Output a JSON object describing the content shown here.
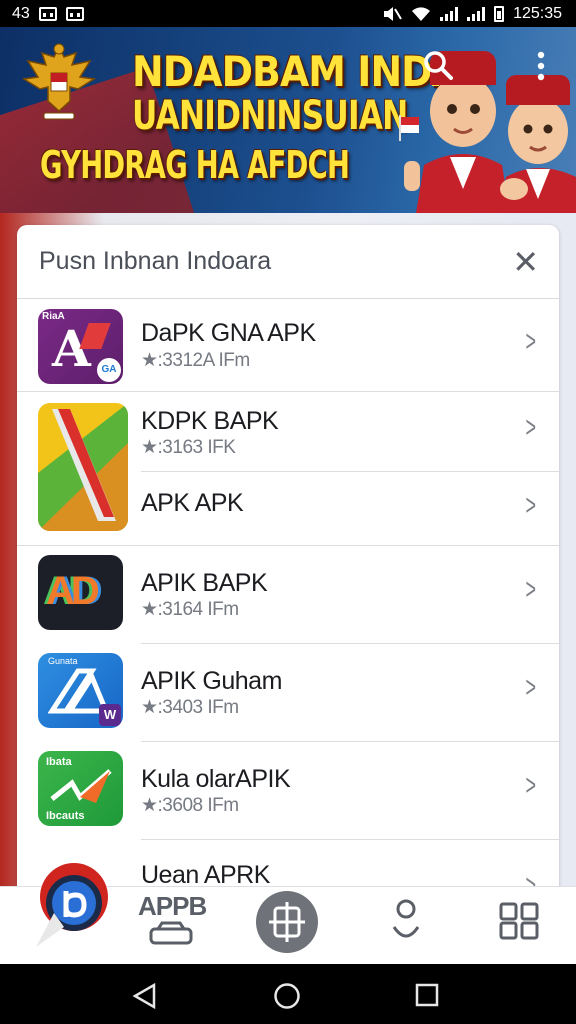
{
  "status_bar": {
    "left_text": "43",
    "time": "125:35"
  },
  "banner": {
    "line1": "NDADBAM INDAD",
    "line2": "UANIDNINSUIAN",
    "line3": "GYHDRAG HA AFDCH",
    "search_icon": "search-icon",
    "menu_icon": "more-vert-icon"
  },
  "sheet": {
    "title": "Pusn Inbnan Indoara",
    "close_icon": "close-icon",
    "items": [
      {
        "name": "DaPK GNA APK",
        "meta": "★:3312A IFm",
        "icon_text": "RiaA",
        "icon_badge": "GA"
      },
      {
        "name": "KDPK BAPK",
        "meta": "★:3163 IFK"
      },
      {
        "name": "APK APK",
        "meta": ""
      },
      {
        "name": "APIK BAPK",
        "meta": "★:3164 IFm",
        "icon_text": "AD"
      },
      {
        "name": "APIK Guham",
        "meta": "★:3403 IFm",
        "icon_text": "Gunata",
        "icon_badge": "W"
      },
      {
        "name": "Kula olarAPIK",
        "meta": "★:3608 IFm",
        "icon_text": "Ibata",
        "icon_text2": "Ibcauts"
      },
      {
        "name": "Uean APRK",
        "meta": ""
      }
    ]
  },
  "bottom_nav": {
    "app_label": "APPB"
  },
  "colors": {
    "accent": "#ffe23a",
    "banner_blue": "#16447f",
    "red": "#b8282b"
  }
}
